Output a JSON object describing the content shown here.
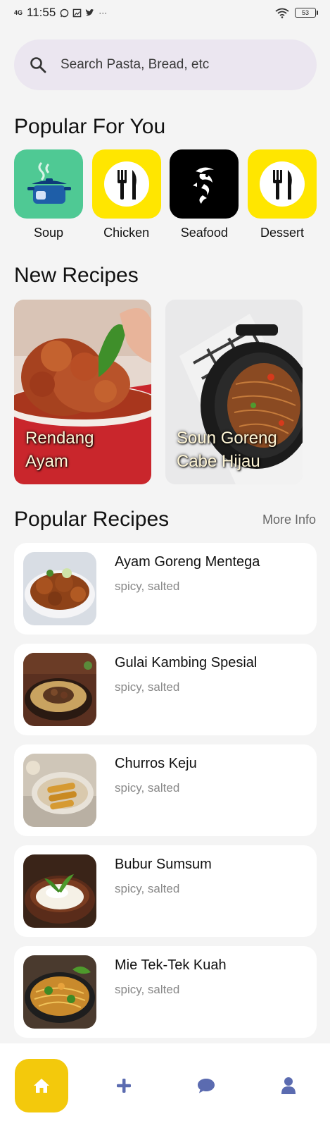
{
  "status_bar": {
    "network": "4G",
    "time": "11:55",
    "icons": [
      "whatsapp-icon",
      "gallery-icon",
      "twitter-icon",
      "more-dots-icon"
    ],
    "battery": "53"
  },
  "search": {
    "placeholder": "Search Pasta, Bread, etc"
  },
  "popular_for_you": {
    "title": "Popular For You",
    "categories": [
      {
        "label": "Soup",
        "icon": "pot-icon",
        "color": "#4fc994"
      },
      {
        "label": "Chicken",
        "icon": "fork-knife-icon",
        "color": "#ffe600"
      },
      {
        "label": "Seafood",
        "icon": "fish-icon",
        "color": "#000000"
      },
      {
        "label": "Dessert",
        "icon": "fork-knife-icon",
        "color": "#ffe600"
      }
    ]
  },
  "new_recipes": {
    "title": "New Recipes",
    "items": [
      {
        "name": "Rendang\nAyam"
      },
      {
        "name": "Soun Goreng\nCabe Hijau"
      }
    ]
  },
  "popular_recipes": {
    "title": "Popular Recipes",
    "more_label": "More Info",
    "items": [
      {
        "title": "Ayam Goreng Mentega",
        "tags": "spicy, salted"
      },
      {
        "title": "Gulai Kambing Spesial",
        "tags": "spicy, salted"
      },
      {
        "title": "Churros Keju",
        "tags": "spicy, salted"
      },
      {
        "title": "Bubur Sumsum",
        "tags": "spicy, salted"
      },
      {
        "title": "Mie Tek-Tek Kuah",
        "tags": "spicy, salted"
      }
    ]
  },
  "bottom_nav": {
    "items": [
      {
        "icon": "home-icon",
        "active": true
      },
      {
        "icon": "plus-icon",
        "active": false
      },
      {
        "icon": "chat-icon",
        "active": false
      },
      {
        "icon": "user-icon",
        "active": false
      }
    ],
    "accent": "#f3c90c",
    "icon_color": "#5b6bb0"
  }
}
